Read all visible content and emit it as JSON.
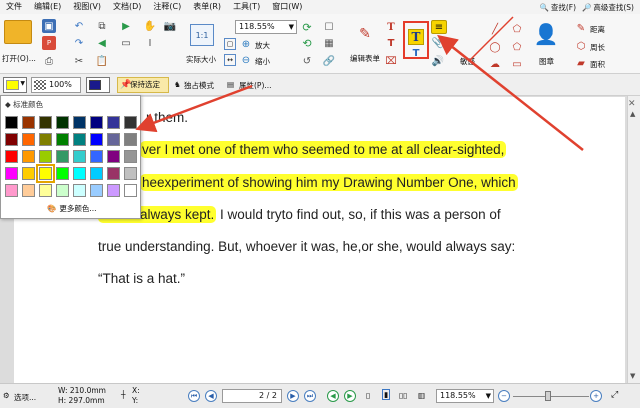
{
  "menu": {
    "items": [
      "文件",
      "编辑(E)",
      "视图(V)",
      "文档(D)",
      "注释(C)",
      "表单(R)",
      "工具(T)",
      "窗口(W)"
    ],
    "find": "查找(F)",
    "advanced_find": "高级查找(S)"
  },
  "ribbon": {
    "open_label": "打开(O)...",
    "zoom_value": "118.55%",
    "actual_size": "实际大小",
    "zoom_in": "放大",
    "zoom_out": "缩小",
    "edit_form": "编辑表单",
    "stamp": "图章",
    "distance": "距离",
    "perimeter": "周长",
    "area": "面积",
    "partial_label": "敏感"
  },
  "toolbar2": {
    "opacity": "100%",
    "keep_selected": "保持选定",
    "exclusive_mode": "独占模式",
    "properties": "属性(P)..."
  },
  "color_popup": {
    "title": "标准颜色",
    "more_colors": "更多颜色...",
    "selected_color": "#ffff00",
    "rows": [
      [
        "#000000",
        "#993300",
        "#333300",
        "#003300",
        "#003366",
        "#000080",
        "#333399",
        "#333333"
      ],
      [
        "#800000",
        "#ff6600",
        "#808000",
        "#008000",
        "#008080",
        "#0000ff",
        "#666699",
        "#808080"
      ],
      [
        "#ff0000",
        "#ff9900",
        "#99cc00",
        "#339966",
        "#33cccc",
        "#3366ff",
        "#800080",
        "#969696"
      ],
      [
        "#ff00ff",
        "#ffcc00",
        "#ffff00",
        "#00ff00",
        "#00ffff",
        "#00ccff",
        "#993366",
        "#c0c0c0"
      ],
      [
        "#ff99cc",
        "#ffcc99",
        "#ffff99",
        "#ccffcc",
        "#ccffff",
        "#99ccff",
        "#cc99ff",
        "#ffffff"
      ]
    ]
  },
  "document": {
    "line1": "r them.",
    "line2": "ver I met one of them who seemed to me at all clear-sighted,",
    "line3": "heexperiment of showing him my Drawing Number One, which",
    "line4a": "always kept.",
    "line4b": " I would tryto find out, so,    if this was a person of",
    "line5": "true understanding. But, whoever it was,    he,or she, would always say:",
    "line6": "“That is a hat.”",
    "highlight_color": "#ffff2e"
  },
  "status": {
    "select_label": "选项...",
    "width": "W: 210.0mm",
    "height": "H: 297.0mm",
    "x": "X:",
    "y": "Y:",
    "page": "2 / 2",
    "zoom": "118.55%"
  }
}
